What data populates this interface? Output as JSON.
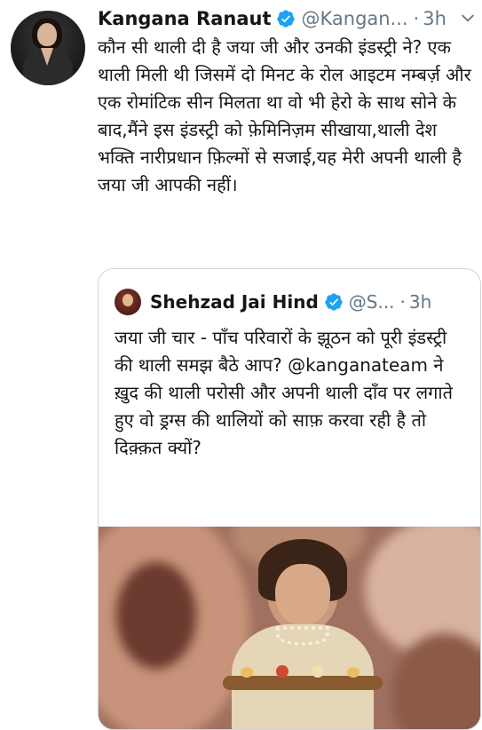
{
  "tweet": {
    "author_name": "Kangana Ranaut",
    "handle": "@Kangan...",
    "separator": "·",
    "time": "3h",
    "text": "कौन सी थाली दी है जया जी और उनकी इंडस्ट्री ने? एक थाली मिली थी जिसमें दो मिनट के रोल आइटम नम्बर्ज़ और एक रोमांटिक सीन मिलता था वो भी हेरो के साथ सोने के बाद,मैंने इस इंडस्ट्री को फ़ेमिनिज़म सीखाया,थाली देश भक्ति नारीप्रधान फ़िल्मों से सजाई,यह मेरी अपनी थाली है जया जी आपकी नहीं।"
  },
  "quoted_tweet": {
    "author_name": "Shehzad Jai Hind",
    "handle": "@S...",
    "separator": "·",
    "time": "3h",
    "text": "जया जी चार - पाँच परिवारों के झूठन को पूरी इंडस्ट्री की थाली समझ बैठे आप? @kanganateam ने ख़ुद की थाली परोसी और अपनी थाली दाँव पर लगाते हुए वो ड्रग्स की थालियों को साफ़ करवा रही है तो दिक़्क़त क्यों?"
  },
  "colors": {
    "verified": "#1da1f2",
    "secondary_text": "#657786",
    "border": "#ccd6dd"
  },
  "icons": {
    "verified": "verified-badge-icon",
    "more": "chevron-down-icon"
  }
}
